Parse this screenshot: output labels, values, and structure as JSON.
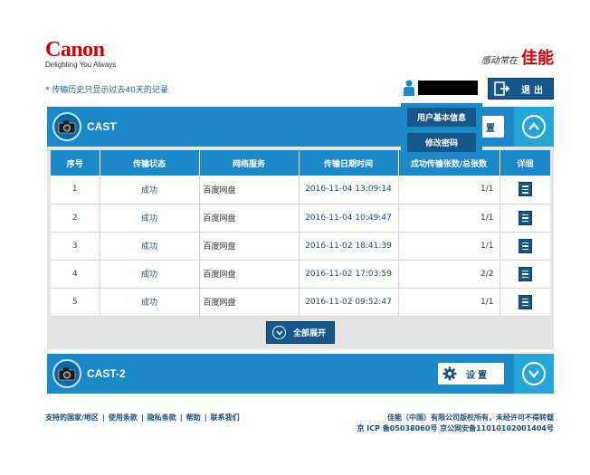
{
  "header": {
    "logo_text": "Canon",
    "logo_tagline": "Delighting You Always",
    "slogan_script": "感动常在",
    "slogan_brand": "佳能"
  },
  "notice": "* 传输历史只显示过去40天的记录",
  "user": {
    "logout_label": "退出"
  },
  "dropdown": {
    "items": [
      "用户基本信息",
      "修改密码"
    ]
  },
  "panel1": {
    "title": "CAST",
    "settings_label": "置"
  },
  "table": {
    "headers": [
      "序号",
      "传输状态",
      "网络服务",
      "传输日期时间",
      "成功传输张数/总张数",
      "详细"
    ],
    "rows": [
      {
        "no": "1",
        "status": "成功",
        "service": "百度网盘",
        "datetime": "2016-11-04 13:09:14",
        "count": "1/1"
      },
      {
        "no": "2",
        "status": "成功",
        "service": "百度网盘",
        "datetime": "2016-11-04 10:49:47",
        "count": "1/1"
      },
      {
        "no": "3",
        "status": "成功",
        "service": "百度网盘",
        "datetime": "2016-11-02 18:41:39",
        "count": "1/1"
      },
      {
        "no": "4",
        "status": "成功",
        "service": "百度网盘",
        "datetime": "2016-11-02 17:03:59",
        "count": "2/2"
      },
      {
        "no": "5",
        "status": "成功",
        "service": "百度网盘",
        "datetime": "2016-11-02 09:52:47",
        "count": "1/1"
      }
    ]
  },
  "expand_label": "全部展开",
  "panel2": {
    "title": "CAST-2",
    "settings_label": "设置"
  },
  "footer": {
    "links": [
      "支持的国家/地区",
      "使用条款",
      "隐私条款",
      "帮助",
      "联系我们"
    ],
    "copyright_line1": "佳能（中国）有限公司版权所有，未经许可不得转载",
    "copyright_line2": "京 ICP 备05038060号 京公网安备110101020014​04号"
  },
  "colors": {
    "brand_red": "#cc0000",
    "panel_blue": "#1b88c7",
    "dark_blue": "#16578b",
    "toggle_blue": "#26a6d6"
  }
}
